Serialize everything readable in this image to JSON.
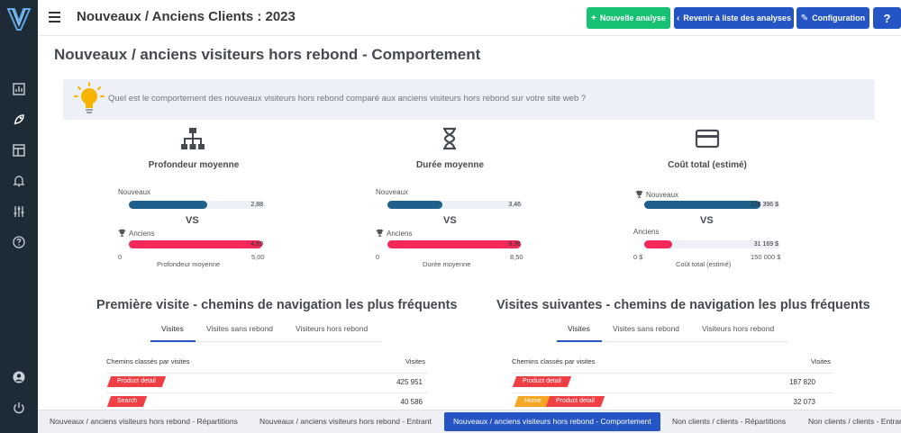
{
  "header": {
    "title": "Nouveaux / Anciens Clients : 2023",
    "buttons": {
      "new_analysis": "Nouvelle analyse",
      "back_to_list": "Revenir à liste des analyses",
      "configuration": "Configuration",
      "help": "?"
    }
  },
  "sidebar": {
    "items": [
      "chart-icon",
      "rocket-icon",
      "layout-icon",
      "bell-icon",
      "sliders-icon",
      "help-circle-icon",
      "user-icon",
      "power-icon"
    ]
  },
  "main": {
    "title": "Nouveaux / anciens visiteurs hors rebond - Comportement",
    "question": "Quel est le comportement des nouveaux visiteurs hors rebond comparé aux anciens visiteurs hors rebond sur votre site web ?",
    "metrics": [
      {
        "icon": "sitemap-icon",
        "title": "Profondeur moyenne",
        "new_label": "Nouveaux",
        "new_value": "2,88",
        "new_ratio": 0.576,
        "new_winner": false,
        "vs": "VS",
        "old_label": "Anciens",
        "old_value": "4,89",
        "old_ratio": 0.978,
        "old_winner": true,
        "axis_min": "0",
        "axis_max": "5,00",
        "axis_label": "Profondeur moyenne"
      },
      {
        "icon": "hourglass-icon",
        "title": "Durée moyenne",
        "new_label": "Nouveaux",
        "new_value": "3,46",
        "new_ratio": 0.407,
        "new_winner": false,
        "vs": "VS",
        "old_label": "Anciens",
        "old_value": "8,36",
        "old_ratio": 0.984,
        "old_winner": true,
        "axis_min": "0",
        "axis_max": "8,50",
        "axis_label": "Durée moyenne"
      },
      {
        "icon": "credit-card-icon",
        "title": "Coût total (estimé)",
        "new_label": "Nouveaux",
        "new_value": "128 396 $",
        "new_ratio": 0.856,
        "new_winner": true,
        "vs": "VS",
        "old_label": "Anciens",
        "old_value": "31 169 $",
        "old_ratio": 0.208,
        "old_winner": false,
        "axis_min": "0 $",
        "axis_max": "150 000 $",
        "axis_label": "Coût total (estimé)"
      }
    ],
    "colors": {
      "new_bar": "#1f5f8b",
      "old_bar": "#f2285a",
      "track": "#eef0f7"
    }
  },
  "paths": [
    {
      "title": "Première visite - chemins de navigation les plus fréquents",
      "tabs": [
        "Visites",
        "Visites sans rebond",
        "Visiteurs hors rebond"
      ],
      "active_tab": 0,
      "col_path": "Chemins classés par visites",
      "col_visits": "Visites",
      "rows": [
        {
          "chips": [
            {
              "label": "Product detail",
              "color": "red"
            }
          ],
          "value": "425 951"
        },
        {
          "chips": [
            {
              "label": "Search",
              "color": "red"
            }
          ],
          "value": "40 586"
        }
      ]
    },
    {
      "title": "Visites suivantes - chemins de navigation les plus fréquents",
      "tabs": [
        "Visites",
        "Visites sans rebond",
        "Visiteurs hors rebond"
      ],
      "active_tab": 0,
      "col_path": "Chemins classés par visites",
      "col_visits": "Visites",
      "rows": [
        {
          "chips": [
            {
              "label": "Product detail",
              "color": "red"
            }
          ],
          "value": "187 820"
        },
        {
          "chips": [
            {
              "label": "Home",
              "color": "orange"
            },
            {
              "label": "Product detail",
              "color": "red"
            }
          ],
          "value": "32 073"
        }
      ]
    }
  ],
  "bottom_tabs": [
    {
      "label": "Nouveaux / anciens visiteurs hors rebond - Répartitions",
      "active": false
    },
    {
      "label": "Nouveaux / anciens visiteurs hors rebond - Entrant",
      "active": false
    },
    {
      "label": "Nouveaux / anciens visiteurs hors rebond - Comportement",
      "active": true
    },
    {
      "label": "Non clients / clients - Répartitions",
      "active": false
    },
    {
      "label": "Non clients / clients - Entrant",
      "active": false
    }
  ]
}
